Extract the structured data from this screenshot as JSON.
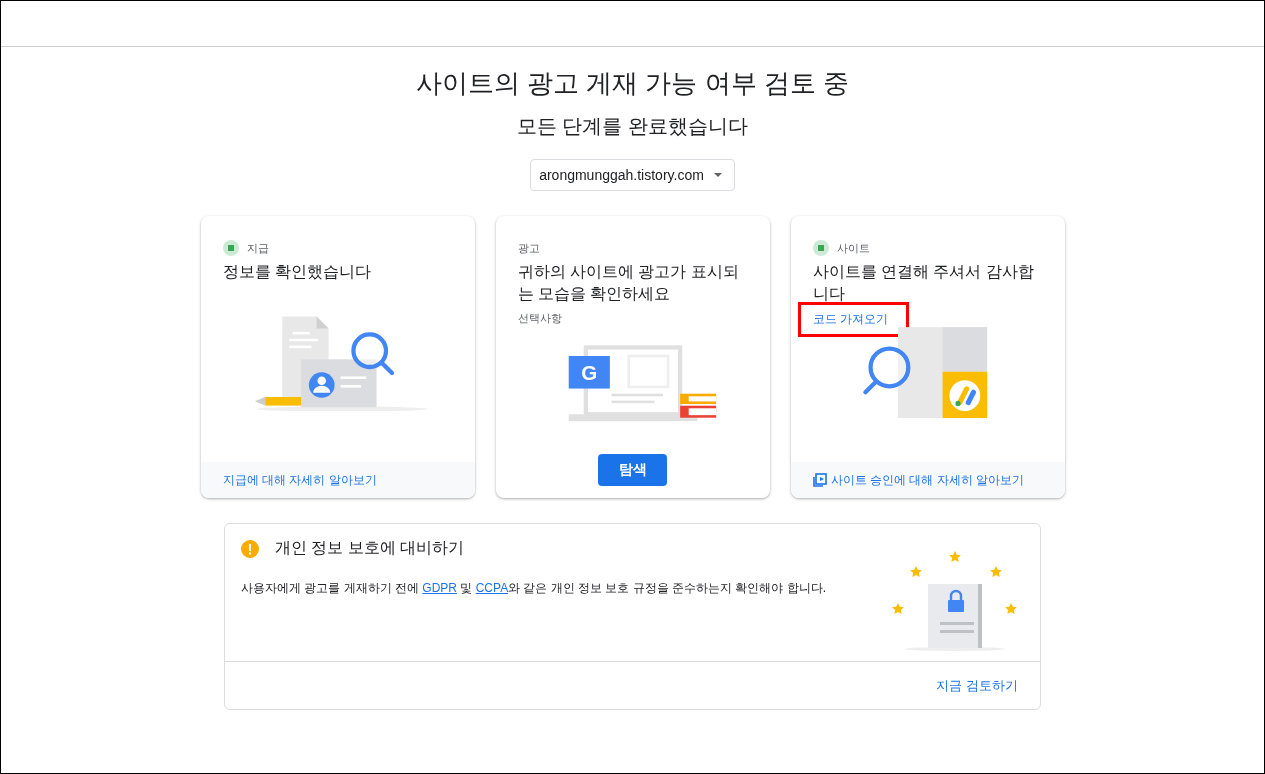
{
  "title": "사이트의 광고 게재 가능 여부 검토 중",
  "subtitle": "모든 단계를 완료했습니다",
  "site_dropdown": {
    "value": "arongmunggah.tistory.com"
  },
  "cards": [
    {
      "kind": "payment",
      "done": true,
      "category": "지급",
      "heading": "정보를 확인했습니다",
      "footer_link": {
        "text": "지급에 대해 자세히 알아보기",
        "icon": false
      }
    },
    {
      "kind": "ads",
      "done": false,
      "category": "광고",
      "heading": "귀하의 사이트에 광고가 표시되는 모습을 확인하세요",
      "note": "선택사항",
      "logo_letter": "G",
      "button": "탐색"
    },
    {
      "kind": "site",
      "done": true,
      "category": "사이트",
      "heading": "사이트를 연결해 주셔서 감사합니다",
      "link": {
        "text": "코드 가져오기",
        "highlighted": true
      },
      "footer_link": {
        "text": "사이트 승인에 대해 자세히 알아보기",
        "icon": true
      }
    }
  ],
  "privacy": {
    "heading": "개인 정보 보호에 대비하기",
    "body": [
      {
        "kind": "text",
        "text": "사용자에게 광고를 게재하기 전에 "
      },
      {
        "kind": "link",
        "text": "GDPR"
      },
      {
        "kind": "text",
        "text": " 및 "
      },
      {
        "kind": "link",
        "text": "CCPA"
      },
      {
        "kind": "text",
        "text": "와 같은 개인 정보 보호 규정을 준수하는지 확인해야 합니다."
      }
    ],
    "action": "지금 검토하기"
  }
}
